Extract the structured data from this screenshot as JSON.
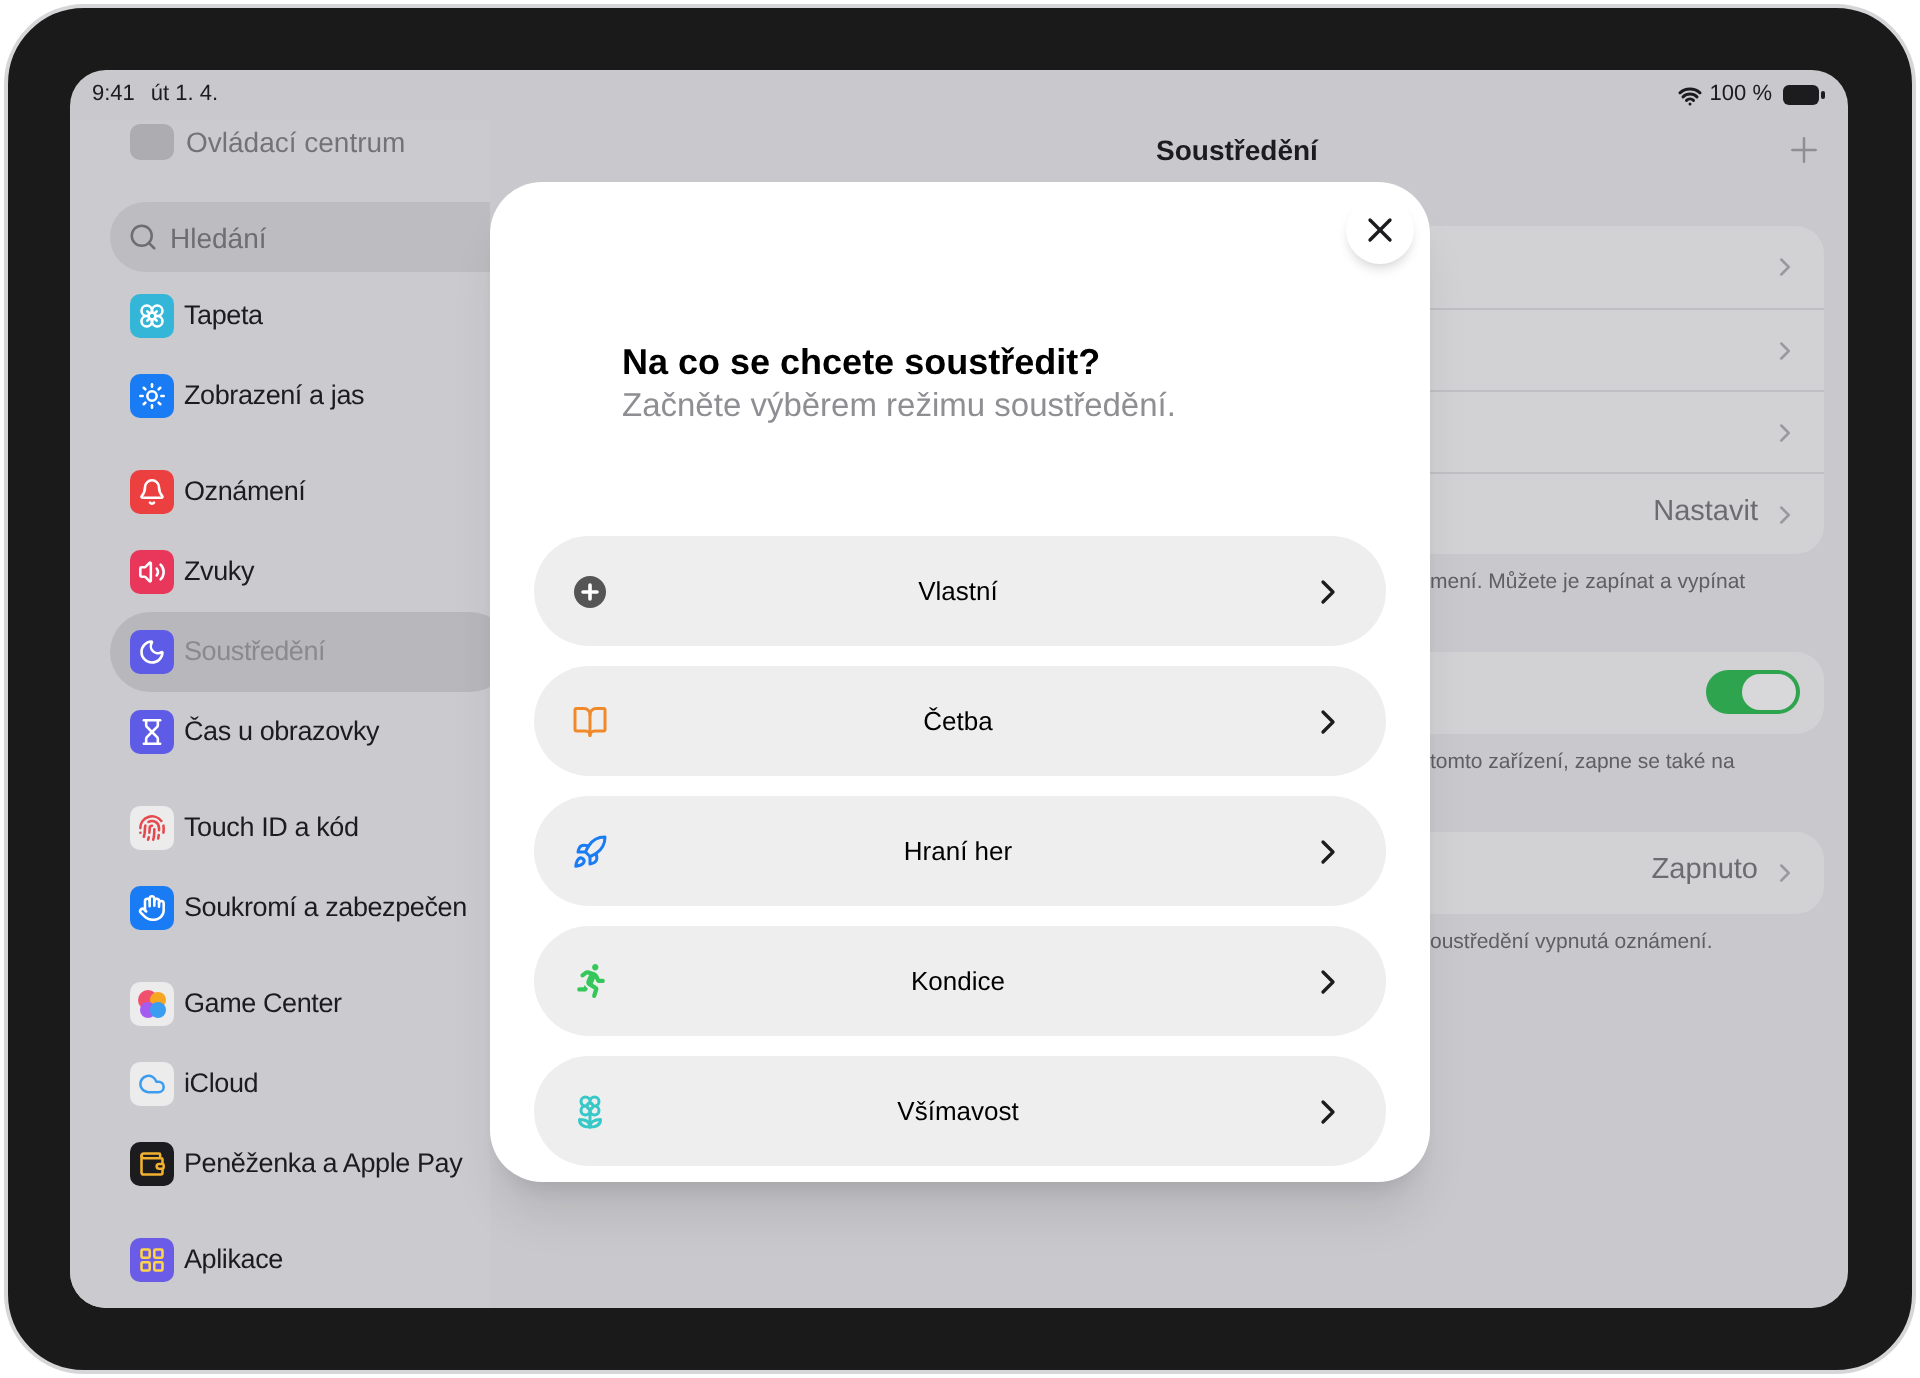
{
  "status_bar": {
    "time": "9:41",
    "date": "út 1. 4.",
    "battery": "100 %"
  },
  "sidebar": {
    "partial_item": "Ovládací centrum",
    "search": {
      "placeholder": "Hledání"
    },
    "groups": [
      [
        {
          "label": "Tapeta",
          "selected": false
        },
        {
          "label": "Zobrazení a jas",
          "selected": false
        }
      ],
      [
        {
          "label": "Oznámení",
          "selected": false
        },
        {
          "label": "Zvuky",
          "selected": false
        },
        {
          "label": "Soustředění",
          "selected": true
        },
        {
          "label": "Čas u obrazovky",
          "selected": false
        }
      ],
      [
        {
          "label": "Touch ID a kód",
          "selected": false
        },
        {
          "label": "Soukromí a zabezpečen",
          "selected": false
        }
      ],
      [
        {
          "label": "Game Center",
          "selected": false
        },
        {
          "label": "iCloud",
          "selected": false
        },
        {
          "label": "Peněženka a Apple Pay",
          "selected": false
        }
      ],
      [
        {
          "label": "Aplikace",
          "selected": false
        }
      ]
    ]
  },
  "detail": {
    "title": "Soustředění",
    "sections": [
      {
        "rows": [
          {
            "kind": "link"
          },
          {
            "kind": "link"
          },
          {
            "kind": "link"
          },
          {
            "kind": "link",
            "value": "Nastavit"
          }
        ],
        "footer": "mení. Můžete je zapínat a vypínat"
      },
      {
        "rows": [
          {
            "kind": "toggle",
            "on": true
          }
        ],
        "footer": "tomto zařízení, zapne se také na"
      },
      {
        "rows": [
          {
            "kind": "link",
            "value": "Zapnuto"
          }
        ],
        "footer": "oustředění vypnutá oznámení."
      }
    ]
  },
  "modal": {
    "title": "Na co se chcete soustředit?",
    "subtitle": "Začněte výběrem režimu soustředění.",
    "options": [
      {
        "label": "Vlastní"
      },
      {
        "label": "Četba"
      },
      {
        "label": "Hraní her"
      },
      {
        "label": "Kondice"
      },
      {
        "label": "Všímavost"
      }
    ]
  }
}
